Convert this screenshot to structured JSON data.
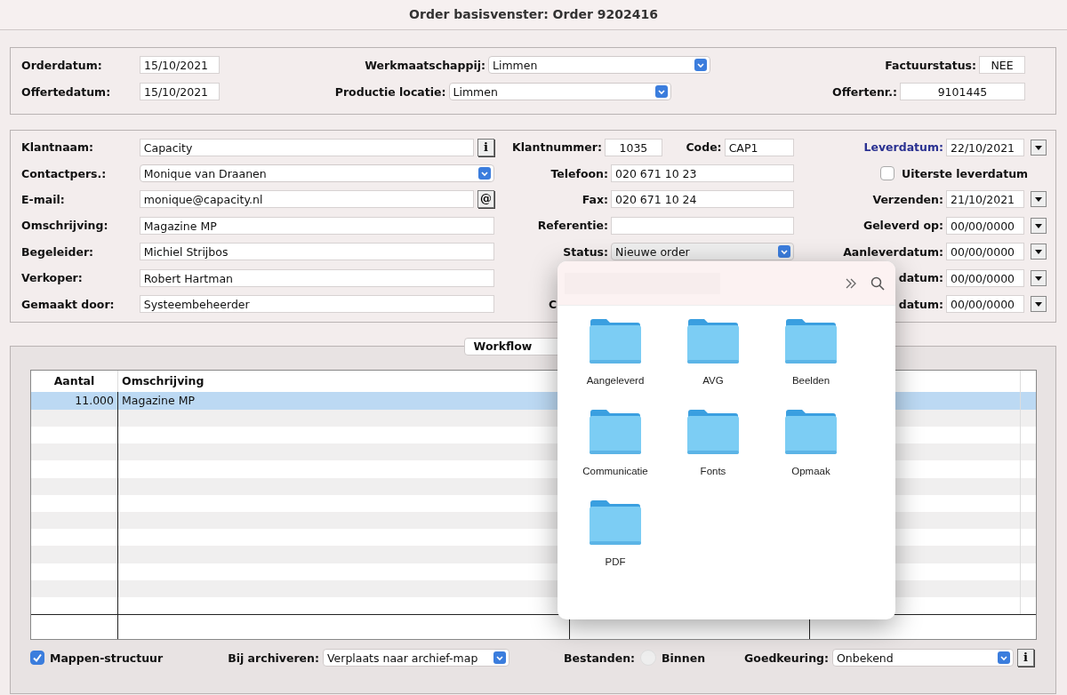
{
  "window": {
    "title": "Order basisvenster: Order 9202416"
  },
  "header_panel": {
    "rows": [
      {
        "left": {
          "label": "Orderdatum:",
          "value": "15/10/2021"
        },
        "middle": {
          "label": "Werkmaatschappij:",
          "value": "Limmen"
        },
        "right": {
          "label": "Factuurstatus:",
          "value": "NEE"
        }
      },
      {
        "left": {
          "label": "Offertedatum:",
          "value": "15/10/2021"
        },
        "middle": {
          "label": "Productie locatie:",
          "value": "Limmen"
        },
        "right": {
          "label": "Offertenr.:",
          "value": "9101445"
        }
      }
    ]
  },
  "customer_panel": {
    "left": [
      {
        "kind": "info",
        "label": "Klantnaam:",
        "value": "Capacity",
        "button": "i"
      },
      {
        "kind": "select",
        "label": "Contactpers.:",
        "value": "Monique van Draanen"
      },
      {
        "kind": "email",
        "label": "E-mail:",
        "value": "monique@capacity.nl",
        "button": "@"
      },
      {
        "kind": "text",
        "label": "Omschrijving:",
        "value": "Magazine MP"
      },
      {
        "kind": "text",
        "label": "Begeleider:",
        "value": "Michiel Strijbos"
      },
      {
        "kind": "text",
        "label": "Verkoper:",
        "value": "Robert Hartman"
      },
      {
        "kind": "text",
        "label": "Gemaakt door:",
        "value": "Systeembeheerder"
      }
    ],
    "middle": [
      {
        "kind": "pair",
        "label": "Klantnummer:",
        "value": "1035",
        "label_2": "Code:",
        "value_2": "CAP1"
      },
      {
        "kind": "text",
        "label": "Telefoon:",
        "value": "020 671 10 23"
      },
      {
        "kind": "text",
        "label": "Fax:",
        "value": "020 671 10 24"
      },
      {
        "kind": "text",
        "label": "Referentie:"
      },
      {
        "kind": "select",
        "label": "Status:",
        "value": "Nieuwe order"
      },
      {
        "kind": "blank"
      },
      {
        "kind": "cut",
        "label": "C"
      }
    ],
    "right": [
      {
        "kind": "date",
        "label": "Leverdatum:",
        "value": "22/10/2021",
        "highlighted": true
      },
      {
        "kind": "check",
        "label": "Uiterste leverdatum",
        "checked": false
      },
      {
        "kind": "date",
        "label": "Verzenden:",
        "value": "21/10/2021",
        "highlighted": false
      },
      {
        "kind": "date",
        "label": "Geleverd op:",
        "value": "00/00/0000",
        "highlighted": false
      },
      {
        "kind": "date",
        "label": "Aanleverdatum:",
        "value": "00/00/0000",
        "highlighted": false
      },
      {
        "kind": "date",
        "label": "datum:",
        "value": "00/00/0000",
        "highlighted": false
      },
      {
        "kind": "date",
        "label": "datum:",
        "value": "00/00/0000",
        "highlighted": false
      }
    ]
  },
  "tabs": [
    {
      "label": "Workflow",
      "selected": true
    }
  ],
  "table": {
    "columns": [
      "Aantal",
      "Omschrijving"
    ],
    "rows": [
      {
        "cells": [
          "11.000",
          "Magazine MP"
        ],
        "selected": true
      }
    ]
  },
  "footer": {
    "folder_structure": {
      "label": "Mappen-structuur",
      "checked": true
    },
    "archive": {
      "label": "Bij archiveren:",
      "value": "Verplaats naar archief-map"
    },
    "files": {
      "label": "Bestanden:",
      "option": "Binnen",
      "selected": false
    },
    "approval": {
      "label": "Goedkeuring:",
      "value": "Onbekend",
      "button": "i"
    }
  },
  "folder_popup": {
    "folders": [
      {
        "name": "Aangeleverd"
      },
      {
        "name": "AVG"
      },
      {
        "name": "Beelden"
      },
      {
        "name": "Communicatie"
      },
      {
        "name": "Fonts"
      },
      {
        "name": "Opmaak"
      },
      {
        "name": "PDF"
      }
    ]
  }
}
